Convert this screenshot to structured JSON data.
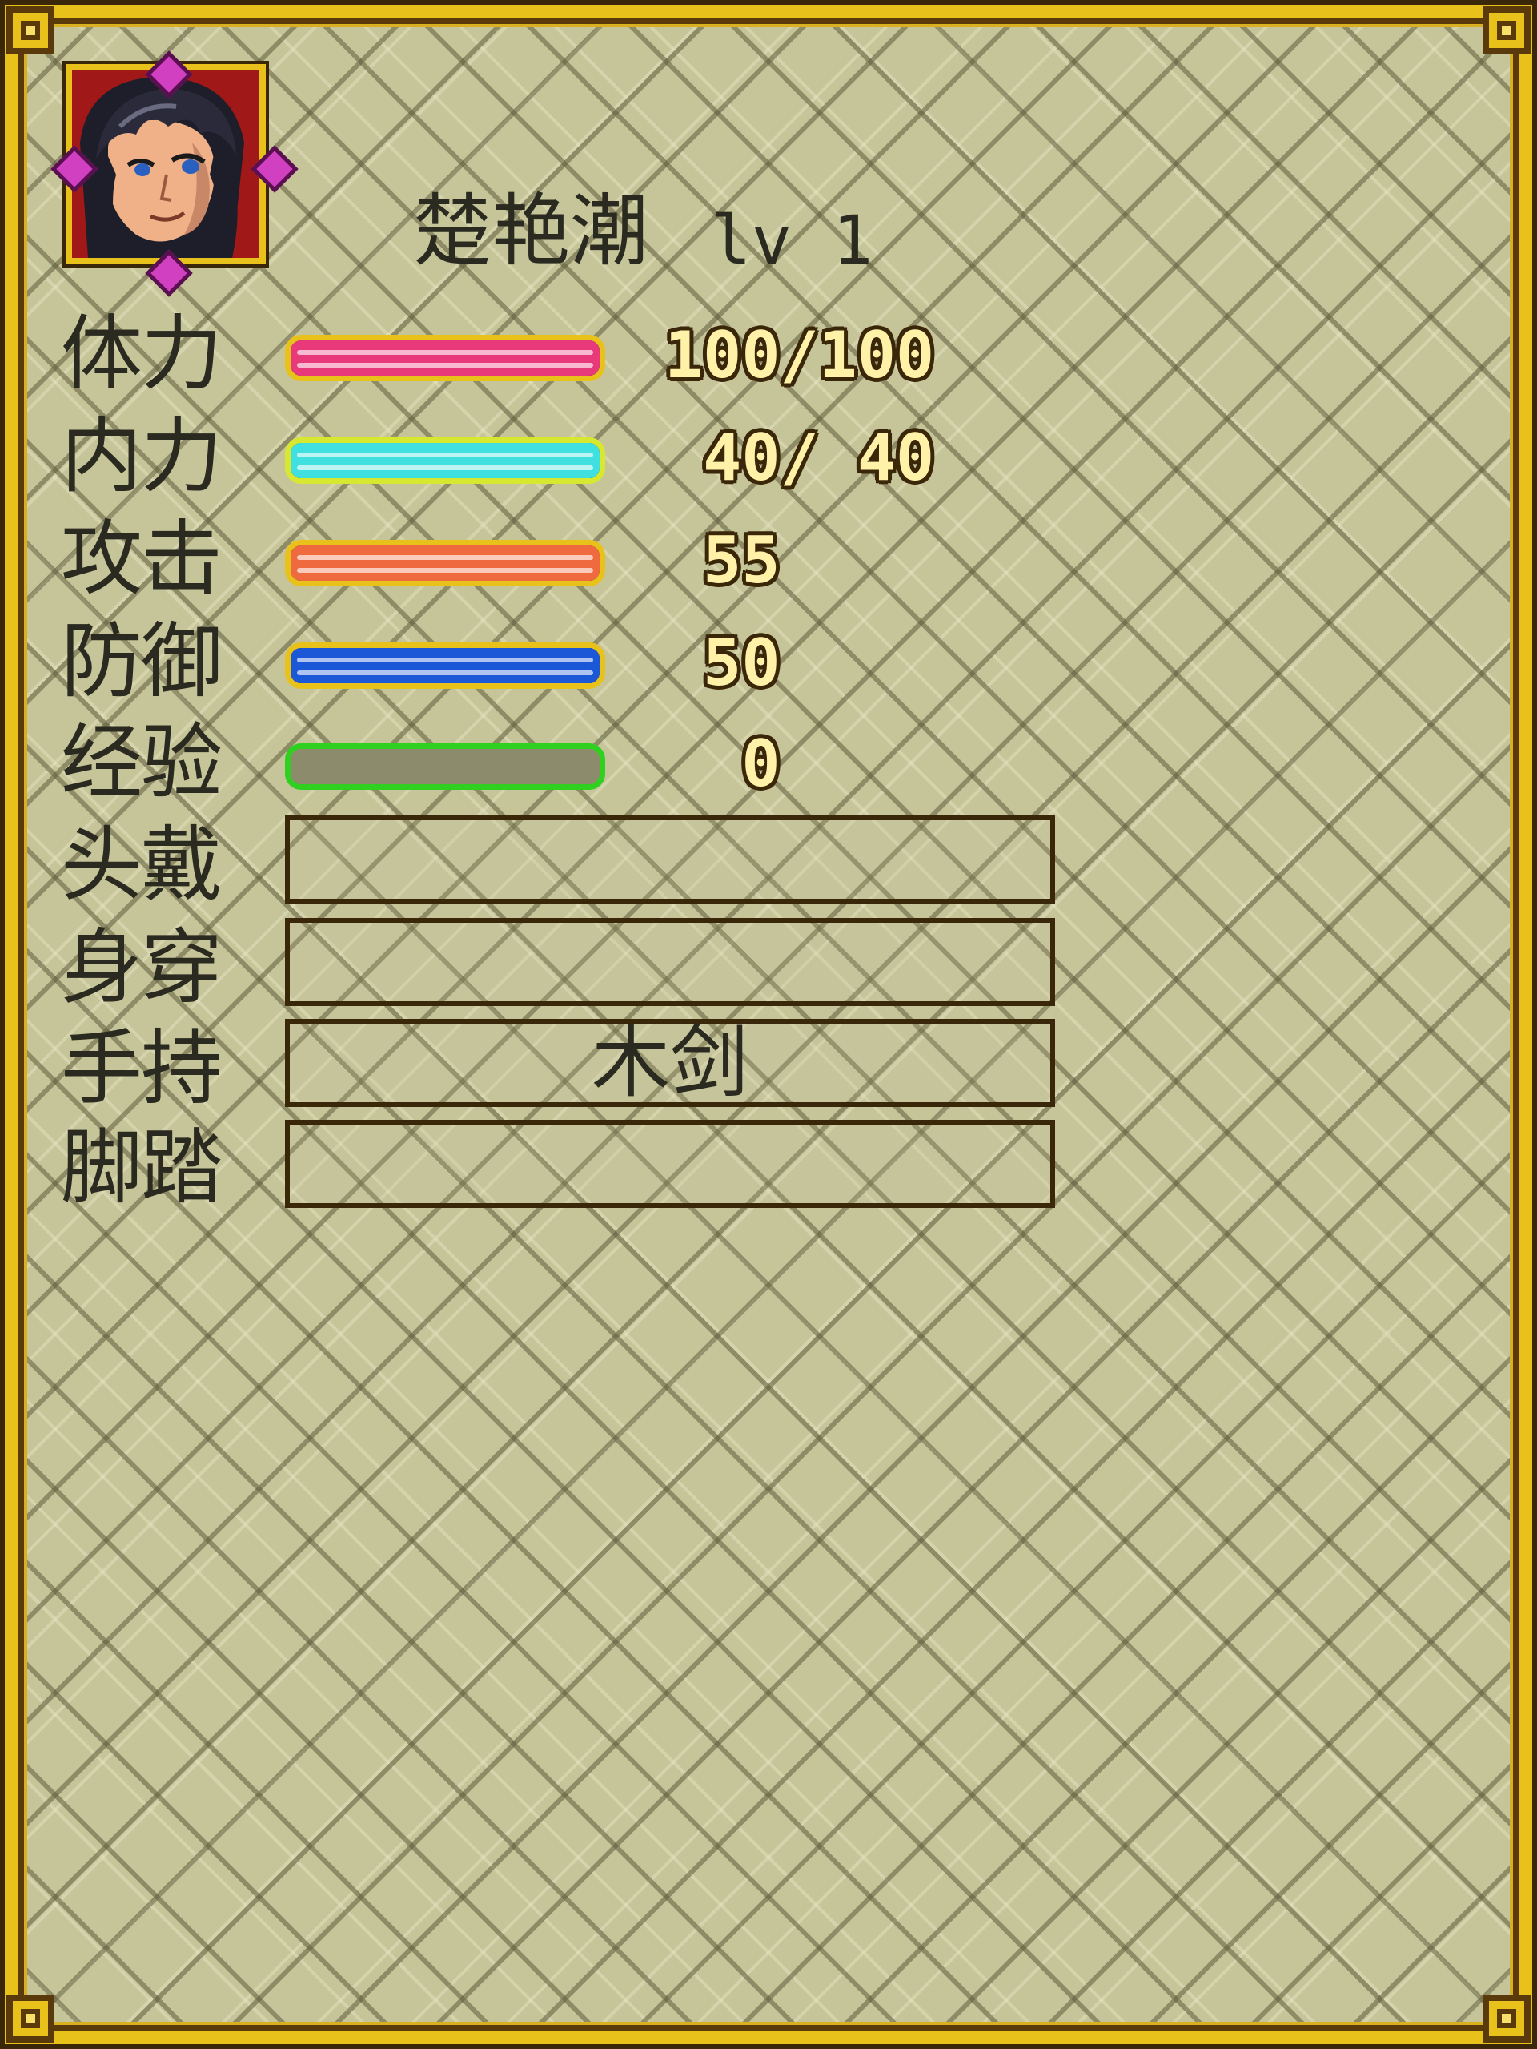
{
  "character": {
    "name": "楚艳潮",
    "level": "lv 1",
    "portrait_icon": "hero-portrait"
  },
  "stats": [
    {
      "label": "体力",
      "value": "100/100",
      "fill_fraction": 1.0,
      "border_color": "#e8c21a",
      "fill_color": "#e83a7a"
    },
    {
      "label": "内力",
      "value": " 40/ 40",
      "fill_fraction": 1.0,
      "border_color": "#d8e830",
      "fill_color": "#40e0e0"
    },
    {
      "label": "攻击",
      "value": " 55",
      "fill_fraction": 1.0,
      "border_color": "#e8c21a",
      "fill_color": "#f06a40"
    },
    {
      "label": "防御",
      "value": " 50",
      "fill_fraction": 1.0,
      "border_color": "#e8c21a",
      "fill_color": "#1a58d8"
    },
    {
      "label": "经验",
      "value": "  0",
      "fill_fraction": 0.0,
      "border_color": "#30d020",
      "fill_color": "#8c8c6c"
    }
  ],
  "equipment": [
    {
      "label": "头戴",
      "item": ""
    },
    {
      "label": "身穿",
      "item": ""
    },
    {
      "label": "手持",
      "item": "木剑"
    },
    {
      "label": "脚踏",
      "item": ""
    }
  ],
  "colors": {
    "frame_gold": "#e8c21a",
    "frame_dark": "#3a2608",
    "panel_bg": "#c6c59a",
    "value_text": "#fff2a8"
  }
}
